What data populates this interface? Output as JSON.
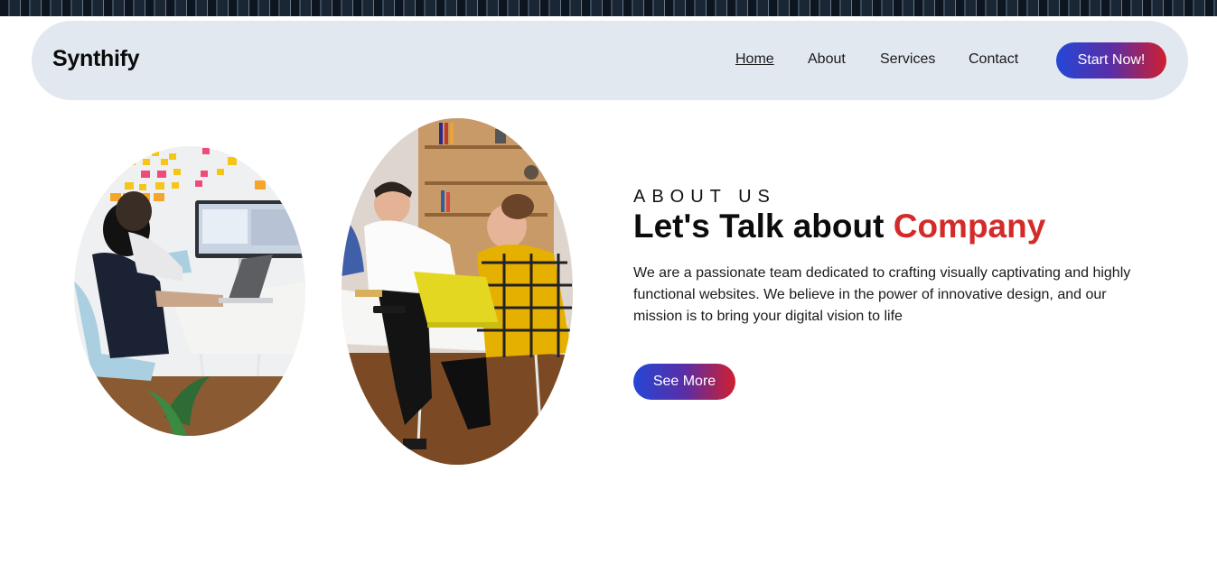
{
  "brand": {
    "name": "Synthify"
  },
  "nav": {
    "links": [
      {
        "label": "Home",
        "active": true
      },
      {
        "label": "About",
        "active": false
      },
      {
        "label": "Services",
        "active": false
      },
      {
        "label": "Contact",
        "active": false
      }
    ],
    "cta_label": "Start Now!"
  },
  "about": {
    "eyebrow": "ABOUT US",
    "headline_main": "Let's Talk about",
    "headline_accent": "Company",
    "description": "We are a passionate team dedicated to crafting visually captivating and highly functional websites. We believe in the power of innovative design, and our mission is to bring your digital vision to life",
    "button_label": "See More"
  },
  "colors": {
    "accent_red": "#d42a2a",
    "gradient_start": "#2447d6",
    "gradient_end": "#cf1f2f",
    "navbar_bg": "#e2e8f0"
  },
  "images": [
    {
      "name": "team-meeting-photo-left"
    },
    {
      "name": "team-meeting-photo-right"
    }
  ]
}
